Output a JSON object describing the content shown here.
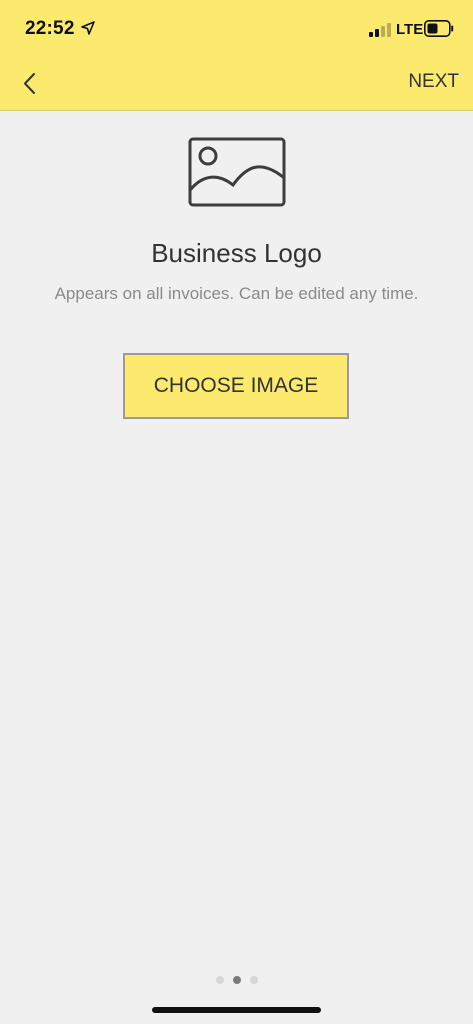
{
  "status_bar": {
    "time": "22:52",
    "network": "LTE",
    "icons": [
      "location-arrow-icon",
      "signal-bars-icon",
      "battery-icon"
    ]
  },
  "nav": {
    "back_icon": "chevron-left-icon",
    "next_label": "NEXT"
  },
  "content": {
    "icon": "image-placeholder-icon",
    "title": "Business Logo",
    "subtitle": "Appears on all invoices. Can be edited any time.",
    "choose_button_label": "CHOOSE IMAGE"
  },
  "pager": {
    "total": 3,
    "active_index": 1
  },
  "colors": {
    "accent": "#fbea6e",
    "background": "#f0f0f0",
    "text": "#333333",
    "muted_text": "#8a8a8a"
  }
}
